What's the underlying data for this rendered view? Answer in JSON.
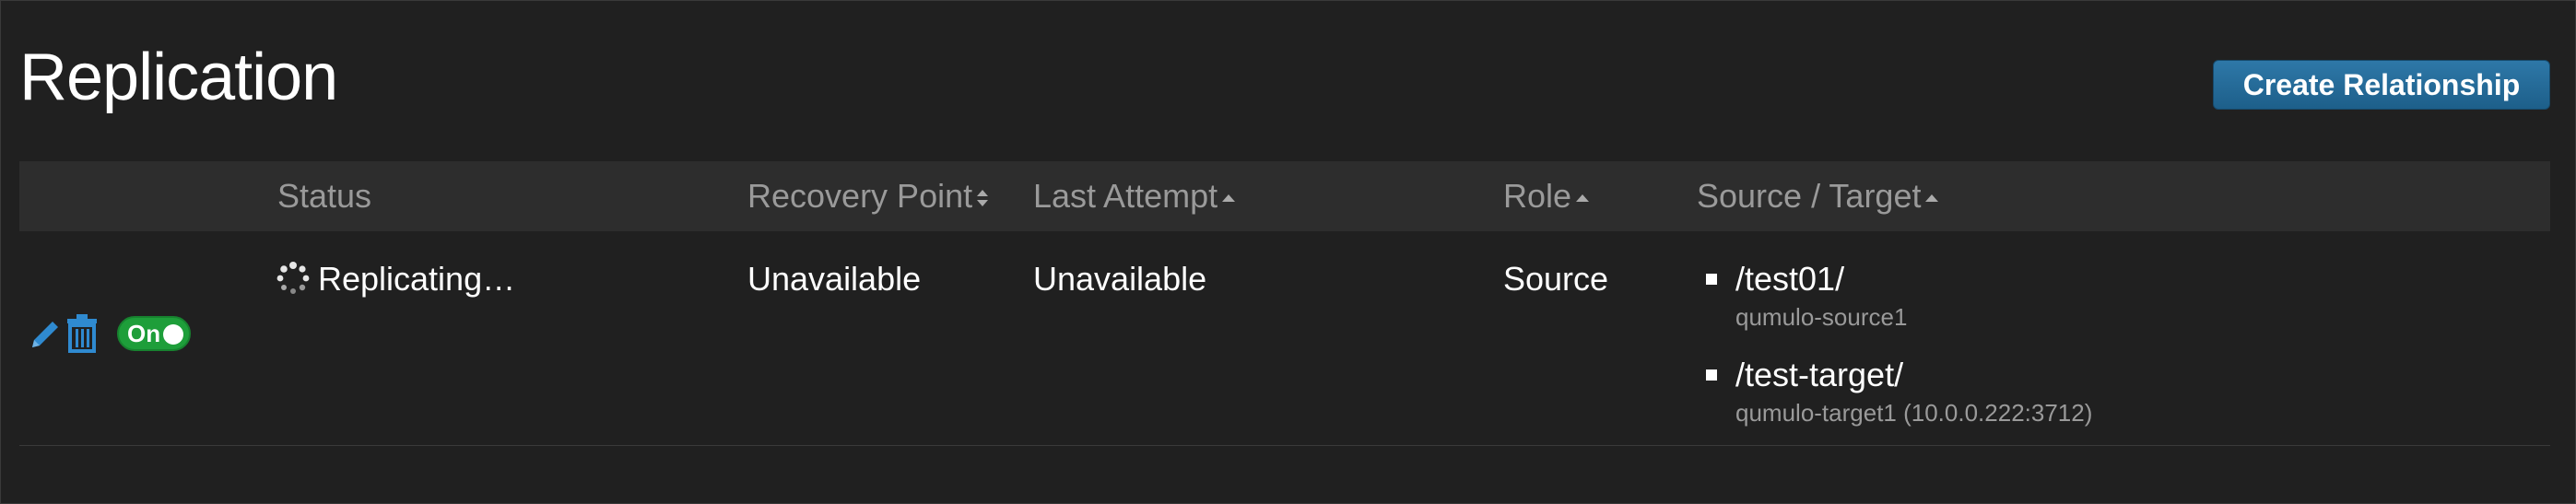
{
  "page": {
    "title": "Replication",
    "create_button_label": "Create Relationship"
  },
  "table": {
    "columns": [
      {
        "label": "Status",
        "sort": "none"
      },
      {
        "label": "Recovery Point",
        "sort": "both"
      },
      {
        "label": "Last Attempt",
        "sort": "up"
      },
      {
        "label": "Role",
        "sort": "up"
      },
      {
        "label": "Source / Target",
        "sort": "up"
      }
    ],
    "rows": [
      {
        "enabled_label": "On",
        "enabled": true,
        "status": "Replicating…",
        "recovery_point": "Unavailable",
        "last_attempt": "Unavailable",
        "role": "Source",
        "source": {
          "path": "/test01/",
          "host": "qumulo-source1"
        },
        "target": {
          "path": "/test-target/",
          "host": "qumulo-target1 (10.0.0.222:3712)"
        }
      }
    ]
  },
  "colors": {
    "background": "#202020",
    "header_bg": "#2d2d2d",
    "button_blue": "#2e78a8",
    "toggle_green": "#1e9e3a",
    "icon_blue": "#2f8ad0"
  },
  "icons": [
    "pencil-icon",
    "trash-icon",
    "spinner-icon",
    "sort-icon"
  ]
}
